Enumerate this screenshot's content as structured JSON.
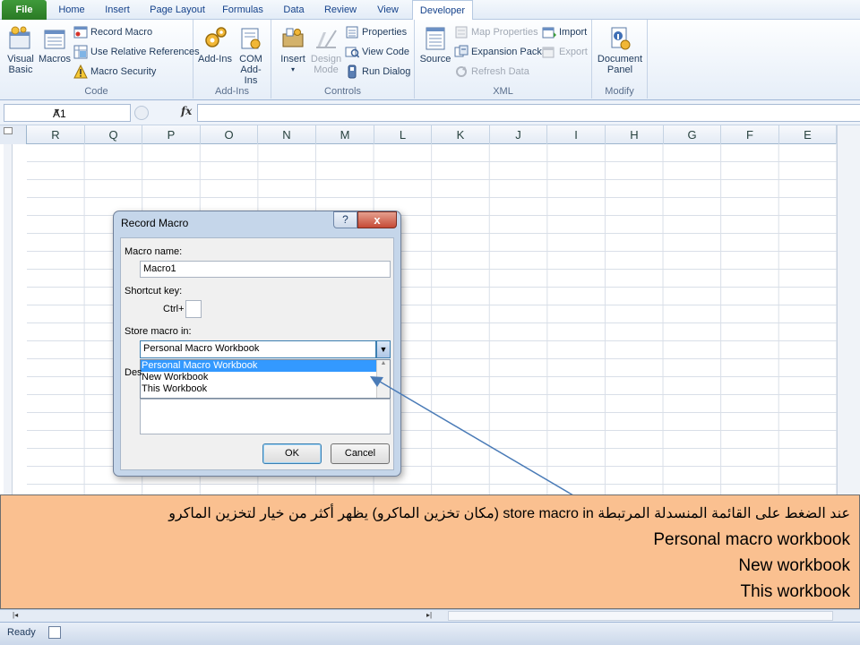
{
  "tabs": [
    {
      "label": "File",
      "type": "file"
    },
    {
      "label": "Home"
    },
    {
      "label": "Insert"
    },
    {
      "label": "Page Layout"
    },
    {
      "label": "Formulas"
    },
    {
      "label": "Data"
    },
    {
      "label": "Review"
    },
    {
      "label": "View"
    },
    {
      "label": "Developer",
      "active": true
    }
  ],
  "ribbon": {
    "code": {
      "label": "Code",
      "visual_basic": "Visual Basic",
      "macros": "Macros",
      "record_macro": "Record Macro",
      "relative_refs": "Use Relative References",
      "macro_security": "Macro Security"
    },
    "addins": {
      "label": "Add-Ins",
      "addins": "Add-Ins",
      "com_addins": "COM Add-Ins"
    },
    "controls": {
      "label": "Controls",
      "insert": "Insert",
      "design_mode": "Design Mode",
      "properties": "Properties",
      "view_code": "View Code",
      "run_dialog": "Run Dialog"
    },
    "xml": {
      "label": "XML",
      "source": "Source",
      "map_properties": "Map Properties",
      "expansion_packs": "Expansion Packs",
      "refresh_data": "Refresh Data",
      "import": "Import",
      "export": "Export"
    },
    "modify": {
      "label": "Modify",
      "document_panel": "Document Panel"
    }
  },
  "formula_bar": {
    "name_box": "A1",
    "fx": "fx",
    "value": ""
  },
  "columns": [
    "R",
    "Q",
    "P",
    "O",
    "N",
    "M",
    "L",
    "K",
    "J",
    "I",
    "H",
    "G",
    "F",
    "E"
  ],
  "dialog": {
    "title": "Record Macro",
    "help": "?",
    "close": "x",
    "macro_name_label": "Macro name:",
    "macro_name_value": "Macro1",
    "shortcut_label": "Shortcut key:",
    "ctrl_label": "Ctrl+",
    "shortcut_value": "",
    "store_label": "Store macro in:",
    "store_value": "Personal Macro Workbook",
    "options": [
      "Personal Macro Workbook",
      "New Workbook",
      "This Workbook"
    ],
    "selected_option": 0,
    "description_label": "Des",
    "ok": "OK",
    "cancel": "Cancel"
  },
  "annotation": {
    "lines": [
      "عند الضغط على القائمة المنسدلة المرتبطة store macro in (مكان تخزين الماكرو) يظهر أكثر من خيار لتخزين الماكرو",
      "Personal macro workbook",
      "New workbook",
      "This workbook"
    ]
  },
  "status": {
    "ready": "Ready"
  }
}
